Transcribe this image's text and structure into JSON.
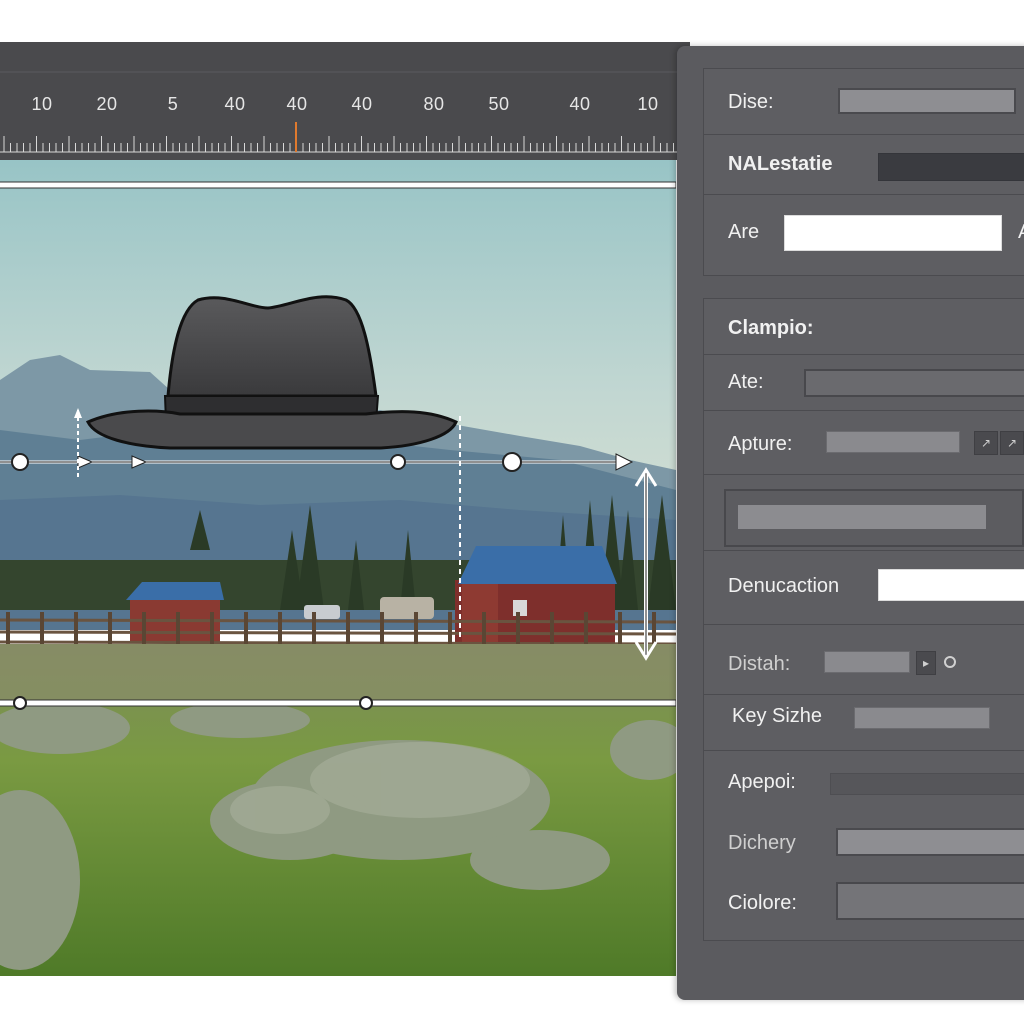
{
  "ruler": {
    "labels": [
      "10",
      "20",
      "5",
      "40",
      "40",
      "40",
      "80",
      "50",
      "40",
      "10"
    ],
    "marker_color": "#e07a2e"
  },
  "canvas": {
    "subject": "hat-icon",
    "scene": "ranch-landscape"
  },
  "panel": {
    "dise_label": "Dise:",
    "nalestatie_label": "NALestatie",
    "are_label": "Are",
    "are_suffix": "A",
    "clampio_label": "Clampio:",
    "ate_label": "Ate:",
    "apture_label": "Apture:",
    "apture_btn1": "↗",
    "apture_btn2": "↗",
    "denucaction_label": "Denucaction",
    "distah_label": "Distah:",
    "distah_btn": "▸",
    "keysizhe_label": "Key Sizhe",
    "apepoi_label": "Apepoi:",
    "dichery_label": "Dichery",
    "ciolore_label": "Ciolore:"
  }
}
